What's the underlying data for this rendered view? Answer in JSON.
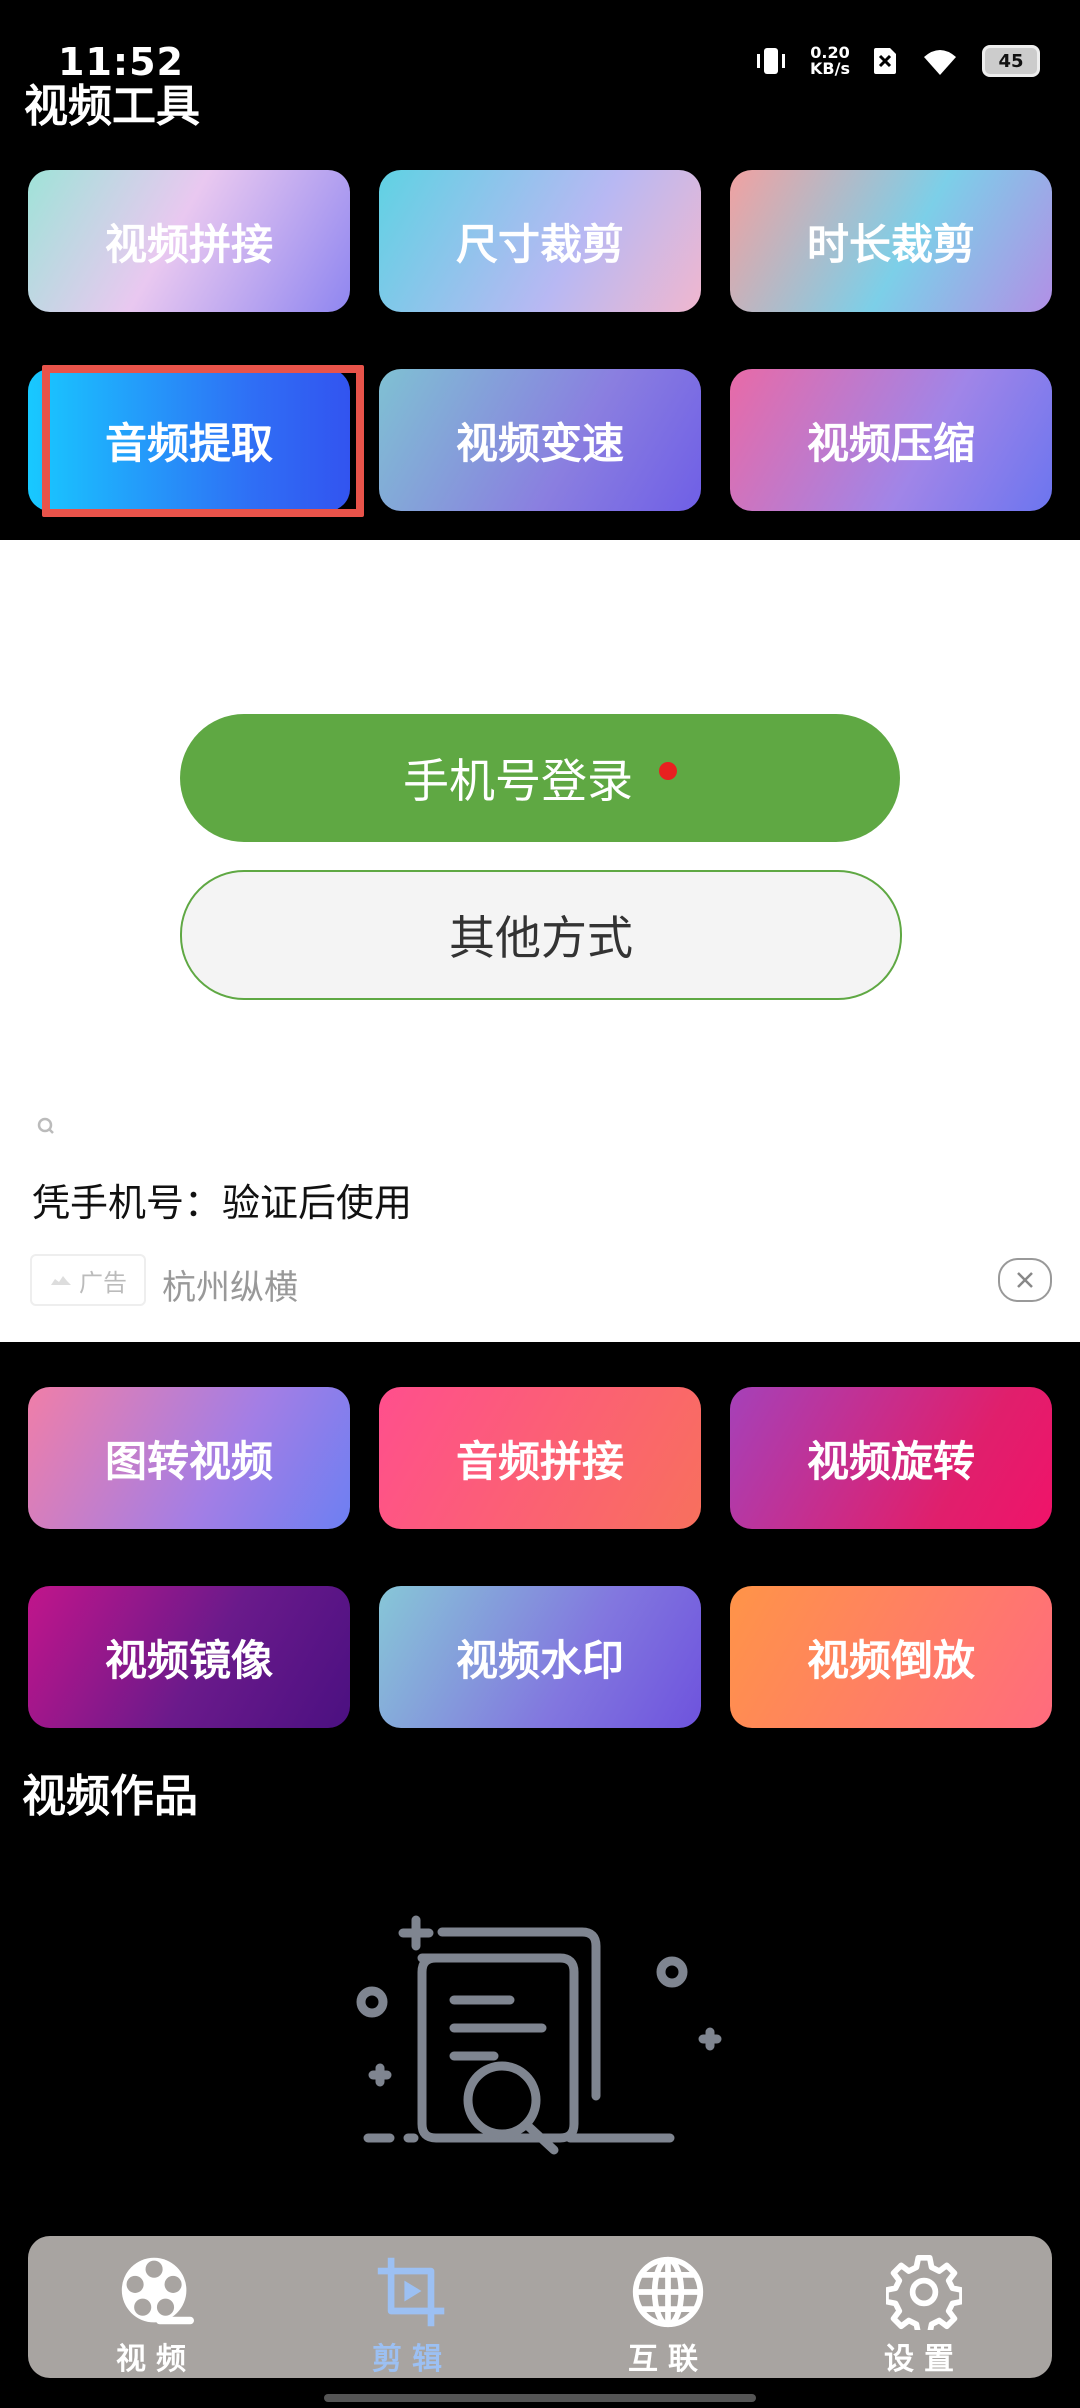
{
  "status": {
    "time": "11:52",
    "net_speed_value": "0.20",
    "net_speed_unit": "KB/s",
    "battery": "45"
  },
  "page_title": "视频工具",
  "top_tools": [
    "视频拼接",
    "尺寸裁剪",
    "时长裁剪",
    "音频提取",
    "视频变速",
    "视频压缩"
  ],
  "bottom_tools": [
    "图转视频",
    "音频拼接",
    "视频旋转",
    "视频镜像",
    "视频水印",
    "视频倒放"
  ],
  "login": {
    "phone_button": "手机号登录",
    "other_button": "其他方式"
  },
  "ad": {
    "title": "凭手机号：验证后使用",
    "badge": "广告",
    "brand": "杭州纵横"
  },
  "works_title": "视频作品",
  "tabs": [
    {
      "label": "视频",
      "icon": "film-reel-icon",
      "active": false
    },
    {
      "label": "剪辑",
      "icon": "crop-play-icon",
      "active": true
    },
    {
      "label": "互联",
      "icon": "globe-icon",
      "active": false
    },
    {
      "label": "设置",
      "icon": "gear-icon",
      "active": false
    }
  ]
}
